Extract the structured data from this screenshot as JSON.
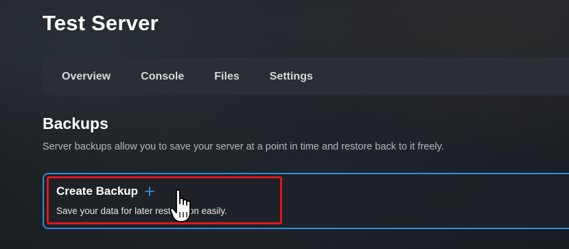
{
  "header": {
    "title": "Test Server"
  },
  "tabs": [
    {
      "label": "Overview"
    },
    {
      "label": "Console"
    },
    {
      "label": "Files"
    },
    {
      "label": "Settings"
    }
  ],
  "backups": {
    "title": "Backups",
    "description": "Server backups allow you to save your server at a point in time and restore back to it freely.",
    "create": {
      "title": "Create Backup",
      "description": "Save your data for later restoration easily.",
      "icon": "plus-icon"
    }
  },
  "cursor": {
    "icon": "hand-pointer-icon"
  },
  "colors": {
    "accent": "#2a8fe0",
    "highlight": "#e0141b",
    "tabbar_bg": "#2a2e35"
  }
}
